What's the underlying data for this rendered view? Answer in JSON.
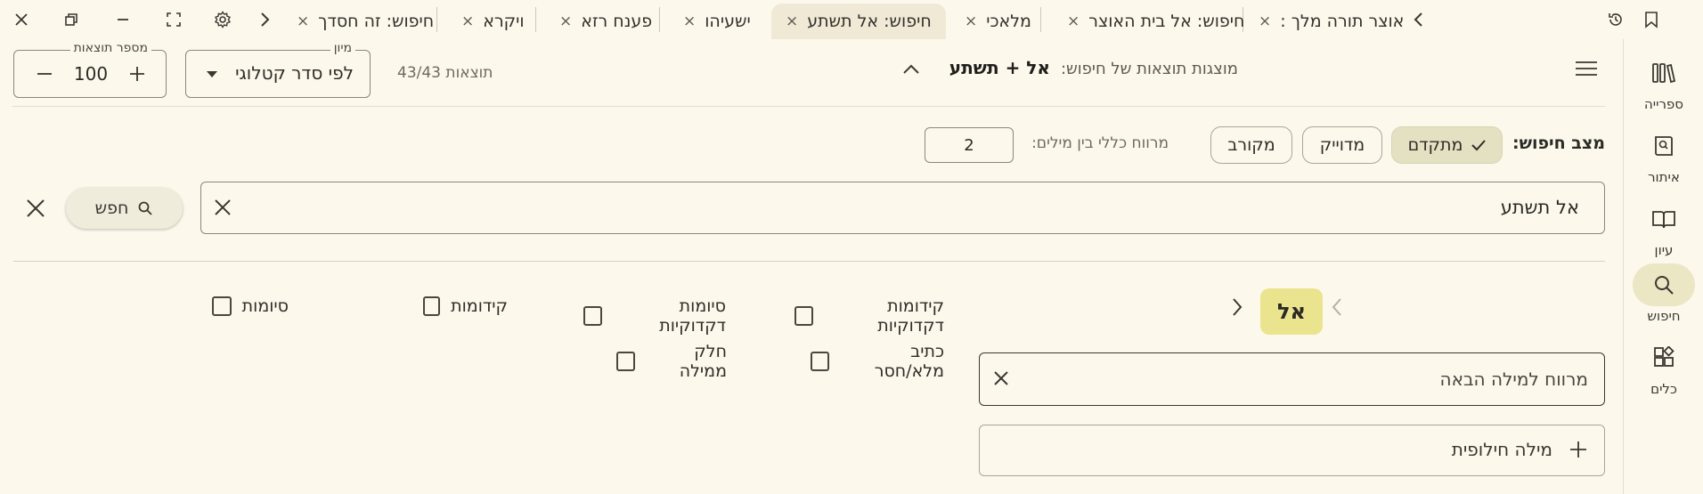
{
  "tabbar": {
    "tabs": [
      {
        "label": "אוצר תורה מלך :",
        "active": false
      },
      {
        "label": "חיפוש: אל בית האוצר",
        "active": false
      },
      {
        "label": "מלאכי",
        "active": false
      },
      {
        "label": "חיפוש: אל תשתע",
        "active": true
      },
      {
        "label": "ישעיהו",
        "active": false
      },
      {
        "label": "פענח רזא",
        "active": false
      },
      {
        "label": "ויקרא",
        "active": false
      },
      {
        "label": "חיפוש: זה חסדך",
        "active": false
      }
    ],
    "close_glyph": "×"
  },
  "rail": {
    "items": [
      {
        "label": "ספרייה",
        "icon": "library-icon"
      },
      {
        "label": "איתור",
        "icon": "locate-book-icon"
      },
      {
        "label": "עיון",
        "icon": "open-book-icon"
      },
      {
        "label": "חיפוש",
        "icon": "search-icon",
        "active": true
      },
      {
        "label": "כלים",
        "icon": "tools-grid-icon"
      }
    ]
  },
  "header": {
    "title_prefix": "מוצגות תוצאות של חיפוש:",
    "query": "אל + תשתע",
    "results_count": "43/43 תוצאות",
    "sort": {
      "legend": "מיון",
      "value": "לפי סדר קטלוגי"
    },
    "results_per_page": {
      "legend": "מספר תוצאות",
      "value": "100"
    }
  },
  "search_mode": {
    "label": "מצב חיפוש:",
    "options": [
      {
        "label": "מתקדם",
        "selected": true
      },
      {
        "label": "מדוייק",
        "selected": false
      },
      {
        "label": "מקורב",
        "selected": false
      }
    ],
    "distance_label": "מרווח כללי בין מילים:",
    "distance_value": "2"
  },
  "search": {
    "query_value": "אל תשתע",
    "search_button": "חפש"
  },
  "word_editor": {
    "current_word": "אל",
    "gap_placeholder": "מרווח למילה הבאה",
    "alt_word_placeholder": "מילה חילופית",
    "options": [
      {
        "label": "קידומות דקדוקיות",
        "checked": false
      },
      {
        "label": "סיומות דקדוקיות",
        "checked": false
      },
      {
        "label": "קידומות",
        "checked": false
      },
      {
        "label": "סיומות",
        "checked": false
      },
      {
        "label": "כתיב מלא/חסר",
        "checked": false
      },
      {
        "label": "חלק ממילה",
        "checked": false
      }
    ]
  },
  "colors": {
    "background": "#fcf8ec",
    "chip_selected": "#e4e1c3",
    "word_chip": "#ebe48f",
    "rail_active": "#ebe6c4"
  }
}
